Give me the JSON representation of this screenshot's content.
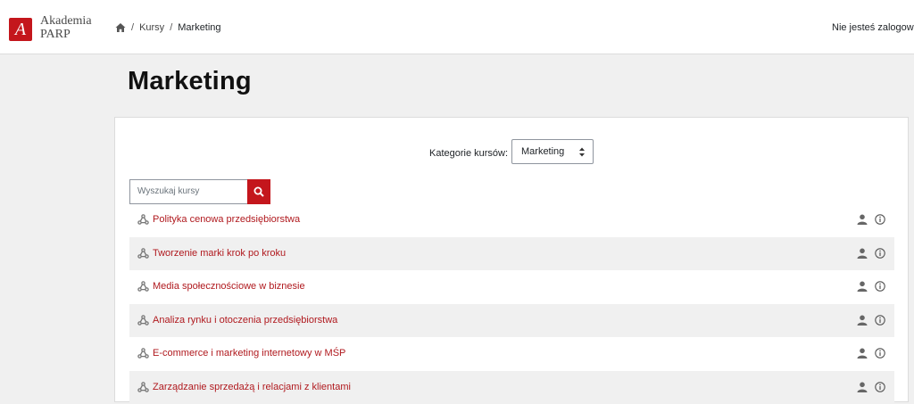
{
  "header": {
    "logo_mark": "A",
    "logo_line1": "Akademia",
    "logo_line2": "PARP",
    "breadcrumb": {
      "sep1": "/",
      "kursy": "Kursy",
      "sep2": "/",
      "current": "Marketing"
    },
    "login_text": "Nie jesteś zalogowany"
  },
  "page": {
    "title": "Marketing"
  },
  "filter": {
    "label": "Kategorie kursów:",
    "selected": "Marketing"
  },
  "search": {
    "placeholder": "Wyszukaj kursy"
  },
  "courses": [
    {
      "name": "Polityka cenowa przedsiębiorstwa"
    },
    {
      "name": "Tworzenie marki krok po kroku"
    },
    {
      "name": "Media społecznościowe w biznesie"
    },
    {
      "name": "Analiza rynku i otoczenia przedsiębiorstwa"
    },
    {
      "name": "E-commerce i marketing internetowy w MŚP"
    },
    {
      "name": "Zarządzanie sprzedażą i relacjami z klientami"
    }
  ],
  "colors": {
    "brand": "#c4161c",
    "link": "#b0191e",
    "row_alt": "#f0f0f0"
  },
  "icons": {
    "home": "home-icon",
    "search": "search-icon",
    "course": "course-icon",
    "user": "user-icon",
    "info": "info-icon"
  }
}
